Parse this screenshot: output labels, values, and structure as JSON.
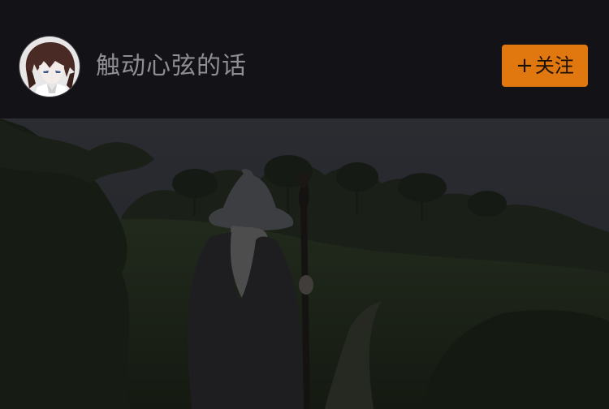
{
  "header": {
    "username": "触动心弦的话",
    "follow_button": {
      "plus": "+",
      "label": "关注"
    }
  },
  "colors": {
    "background": "#121217",
    "username_text": "#8e8e93",
    "follow_button_bg": "#e0780f",
    "follow_button_text": "#1a1006"
  },
  "icons": {
    "avatar": "anime-avatar",
    "plus": "plus-icon"
  }
}
